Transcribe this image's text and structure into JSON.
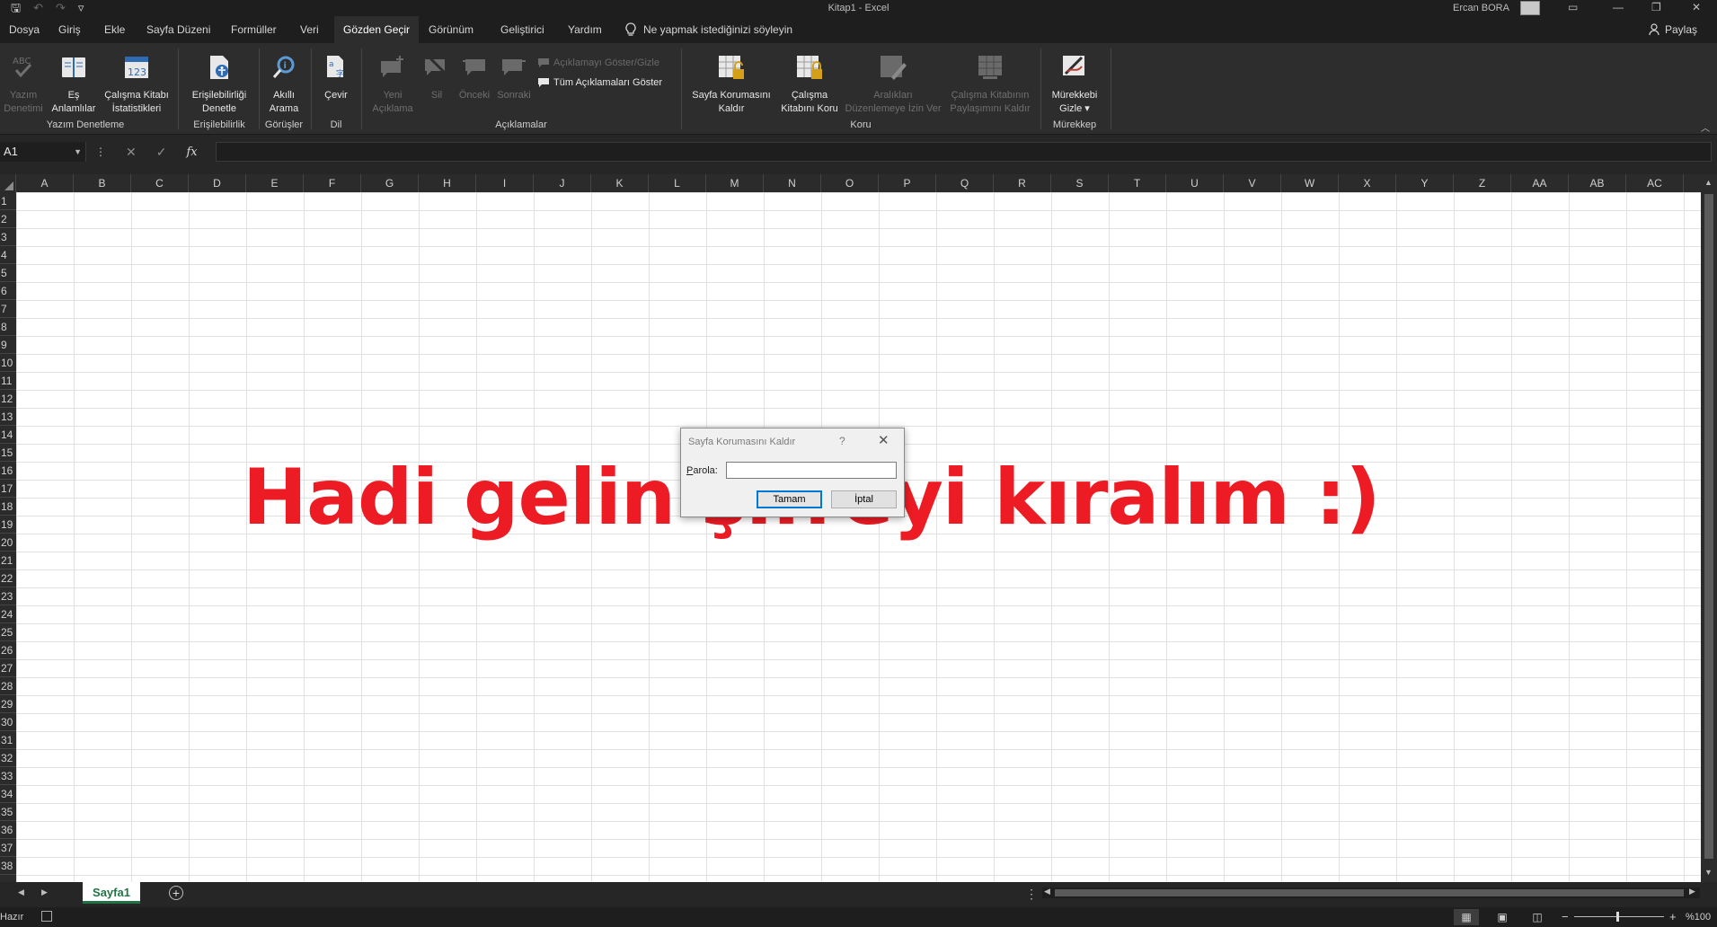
{
  "titlebar": {
    "title": "Kitap1  -  Excel",
    "user": "Ercan BORA",
    "qat": {
      "save": "🖫",
      "undo": "↶",
      "redo": "↷",
      "customize": "▿"
    },
    "window_buttons": {
      "ribbon_options": "▭",
      "minimize": "—",
      "restore": "❐",
      "close": "✕"
    }
  },
  "menu": {
    "items": [
      "Dosya",
      "Giriş",
      "Ekle",
      "Sayfa Düzeni",
      "Formüller",
      "Veri",
      "Gözden Geçir",
      "Görünüm",
      "Geliştirici",
      "Yardım"
    ],
    "active_index": 6,
    "tell_me": "Ne yapmak istediğinizi söyleyin",
    "share": "Paylaş"
  },
  "ribbon": {
    "spelling": {
      "line1": "Yazım",
      "line2": "Denetimi"
    },
    "thesaurus": {
      "line1": "Eş",
      "line2": "Anlamlılar"
    },
    "workbook_stats": {
      "line1": "Çalışma Kitabı",
      "line2": "İstatistikleri"
    },
    "accessibility": {
      "line1": "Erişilebilirliği",
      "line2": "Denetle"
    },
    "smart_lookup": {
      "line1": "Akıllı",
      "line2": "Arama"
    },
    "translate": {
      "line1": "Çevir"
    },
    "new_comment": {
      "line1": "Yeni",
      "line2": "Açıklama"
    },
    "delete": {
      "line1": "Sil"
    },
    "previous": {
      "line1": "Önceki"
    },
    "next": {
      "line1": "Sonraki"
    },
    "show_hide_comment": "Açıklamayı Göster/Gizle",
    "show_all_comments": "Tüm Açıklamaları Göster",
    "unprotect_sheet": {
      "line1": "Sayfa Korumasını",
      "line2": "Kaldır"
    },
    "protect_workbook": {
      "line1": "Çalışma",
      "line2": "Kitabını Koru"
    },
    "allow_edit_ranges": {
      "line1": "Aralıkları",
      "line2": "Düzenlemeye İzin Ver"
    },
    "unshare_workbook": {
      "line1": "Çalışma Kitabının",
      "line2": "Paylaşımını Kaldır"
    },
    "hide_ink": {
      "line1": "Mürekkebi",
      "line2": "Gizle ▾"
    },
    "groups": {
      "proofing": "Yazım Denetleme",
      "accessibility": "Erişilebilirlik",
      "insights": "Görüşler",
      "language": "Dil",
      "comments": "Açıklamalar",
      "protect": "Koru",
      "ink": "Mürekkep"
    }
  },
  "formula_bar": {
    "name_box": "A1",
    "cancel": "✕",
    "enter": "✓",
    "fx": "fx",
    "value": ""
  },
  "sheet": {
    "columns": [
      "A",
      "B",
      "C",
      "D",
      "E",
      "F",
      "G",
      "H",
      "I",
      "J",
      "K",
      "L",
      "M",
      "N",
      "O",
      "P",
      "Q",
      "R",
      "S",
      "T",
      "U",
      "V",
      "W",
      "X",
      "Y",
      "Z",
      "AA",
      "AB",
      "AC"
    ],
    "rows": [
      "1",
      "2",
      "3",
      "4",
      "5",
      "6",
      "7",
      "8",
      "9",
      "10",
      "11",
      "12",
      "13",
      "14",
      "15",
      "16",
      "17",
      "18",
      "19",
      "20",
      "21",
      "22",
      "23",
      "24",
      "25",
      "26",
      "27",
      "28",
      "29",
      "30",
      "31",
      "32",
      "33",
      "34",
      "35",
      "36",
      "37",
      "38"
    ],
    "big_text": "Hadi gelin şifreyi kıralım :)",
    "big_text_color": "#ed1c24"
  },
  "dialog": {
    "title": "Sayfa Korumasını Kaldır",
    "help": "?",
    "close": "✕",
    "password_label": "Parola:",
    "password_value": "",
    "ok": "Tamam",
    "cancel": "İptal"
  },
  "tabs": {
    "sheet_name": "Sayfa1",
    "add": "+",
    "prev": "◀",
    "next": "▶",
    "options": "⋮"
  },
  "status": {
    "ready": "Hazır",
    "zoom": "%100",
    "zoom_minus": "−",
    "zoom_plus": "+"
  },
  "colors": {
    "accent_green": "#217346",
    "dialog_focus": "#0078d7",
    "chrome_dark": "#1e1e1e",
    "ribbon_bg": "#2d2d2d"
  }
}
